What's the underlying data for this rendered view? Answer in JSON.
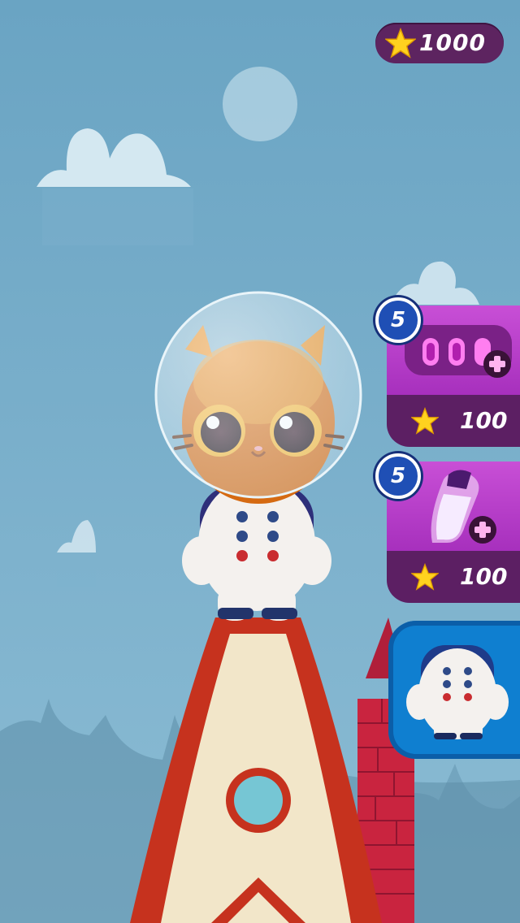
{
  "hud": {
    "stars": "1000",
    "star_icon": "star-icon"
  },
  "powerups": [
    {
      "count": "5",
      "price": "100",
      "icon": "extra-lives-icon"
    },
    {
      "count": "5",
      "price": "100",
      "icon": "booster-jar-icon"
    }
  ],
  "costume_button": {
    "icon": "astronaut-suit-icon"
  },
  "colors": {
    "sky": "#6aa5c4",
    "card_purple": "#b53ec8",
    "card_dark": "#5c1f63",
    "badge_blue": "#1f4fb5",
    "suit_blue": "#0f7fd0",
    "star_yellow": "#ffd21f"
  }
}
